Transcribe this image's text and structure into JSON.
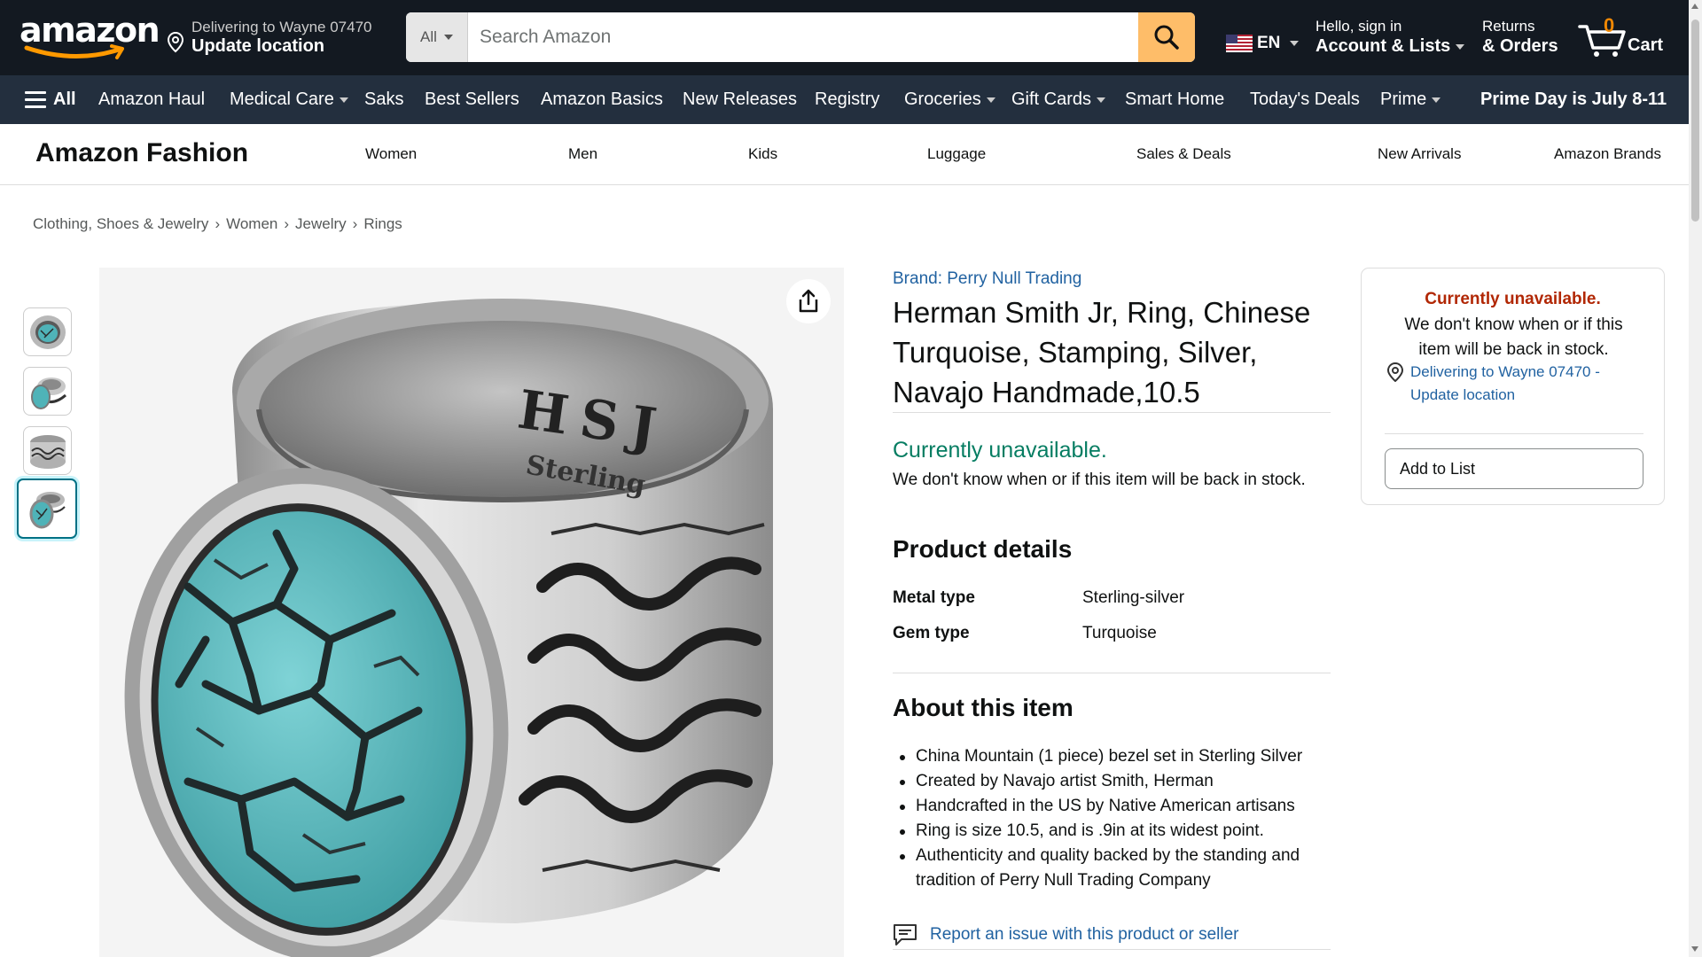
{
  "header": {
    "logo_text": "amazon",
    "deliver_line1": "Delivering to Wayne 07470",
    "deliver_line2": "Update location",
    "search_category": "All",
    "search_placeholder": "Search Amazon",
    "lang_code": "EN",
    "account_line1": "Hello, sign in",
    "account_line2": "Account & Lists",
    "returns_line1": "Returns",
    "returns_line2": "& Orders",
    "cart_count": "0",
    "cart_label": "Cart"
  },
  "subnav": {
    "all_label": "All",
    "items": [
      "Amazon Haul",
      "Medical Care",
      "Saks",
      "Best Sellers",
      "Amazon Basics",
      "New Releases",
      "Registry",
      "Groceries",
      "Gift Cards",
      "Smart Home",
      "Today's Deals",
      "Prime"
    ],
    "promo": "Prime Day is July 8-11"
  },
  "fashion": {
    "title": "Amazon Fashion",
    "links": [
      "Women",
      "Men",
      "Kids",
      "Luggage",
      "Sales & Deals",
      "New Arrivals",
      "Amazon Brands"
    ]
  },
  "breadcrumb": [
    "Clothing, Shoes & Jewelry",
    "Women",
    "Jewelry",
    "Rings"
  ],
  "product": {
    "brand_link": "Brand: Perry Null Trading",
    "title": "Herman Smith Jr, Ring, Chinese Turquoise, Stamping, Silver, Navajo Handmade,10.5",
    "availability": "Currently unavailable.",
    "availability_note": "We don't know when or if this item will be back in stock.",
    "ring_stamp": "HSJ",
    "ring_stamp2": "Sterling",
    "details_heading": "Product details",
    "details": [
      {
        "key": "Metal type",
        "value": "Sterling-silver"
      },
      {
        "key": "Gem type",
        "value": "Turquoise"
      }
    ],
    "about_heading": "About this item",
    "bullets": [
      "China Mountain (1 piece) bezel set in Sterling Silver",
      "Created by Navajo artist Smith, Herman",
      "Handcrafted in the US by Native American artisans",
      "Ring is size 10.5, and is .9in at its widest point.",
      "Authenticity and quality backed by the standing and tradition of Perry Null Trading Company"
    ],
    "report_link": "Report an issue with this product or seller"
  },
  "buybox": {
    "status": "Currently unavailable.",
    "note": "We don't know when or if this item will be back in stock.",
    "location_link": "Delivering to Wayne 07470 - Update location",
    "add_to_list": "Add to List"
  },
  "colors": {
    "nav_dark": "#131921",
    "nav_secondary": "#232f3e",
    "search_button": "#febd69",
    "link_blue": "#2162a1",
    "available_green": "#067d62",
    "unavailable_red": "#b12704",
    "cart_orange": "#f08804"
  },
  "icons": {
    "deliver": "location-pin-icon",
    "search": "magnifier-icon",
    "flag": "us-flag-icon",
    "cart": "cart-icon",
    "menu": "hamburger-icon",
    "share": "share-icon",
    "report": "comment-icon"
  }
}
